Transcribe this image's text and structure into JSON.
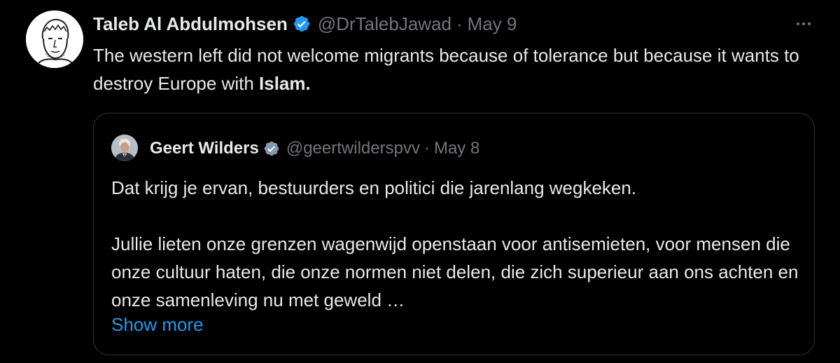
{
  "tweet": {
    "author": {
      "name": "Taleb Al Abdulmohsen",
      "handle": "@DrTalebJawad",
      "verified": true,
      "avatar": "sketch-portrait-avatar"
    },
    "separator": "·",
    "date": "May 9",
    "text_before_bold": "The western left did not welcome migrants because of tolerance but because it wants to destroy Europe with ",
    "text_bold": "Islam.",
    "more_icon": "ellipsis-icon"
  },
  "quoted_tweet": {
    "author": {
      "name": "Geert Wilders",
      "handle": "@geertwilderspvv",
      "verified": true,
      "badge_color": "#829aab"
    },
    "separator": "·",
    "date": "May 8",
    "paragraph_1": "Dat krijg je ervan, bestuurders en politici die jarenlang wegkeken.",
    "paragraph_2": "Jullie lieten onze grenzen wagenwijd openstaan voor antisemieten, voor mensen die onze cultuur haten, die onze normen niet delen, die zich superieur aan ons achten en onze samenleving nu met geweld …",
    "show_more_label": "Show more"
  },
  "colors": {
    "background": "#000000",
    "text_primary": "#e7e9ea",
    "text_secondary": "#71767b",
    "link": "#1d9bf0",
    "verified_blue": "#1d9bf0",
    "border": "#2f3336"
  }
}
